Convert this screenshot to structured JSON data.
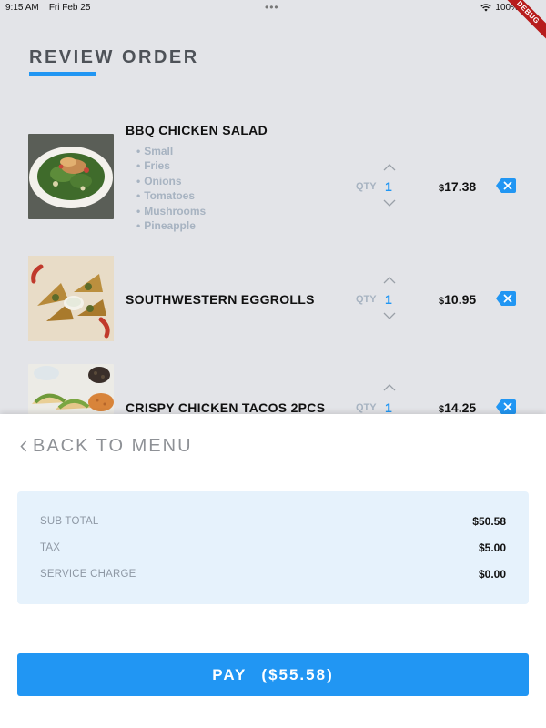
{
  "status_bar": {
    "time": "9:15 AM",
    "date": "Fri Feb 25",
    "center_dots": "•••",
    "battery": "100%",
    "debug_label": "DEBUG"
  },
  "header": {
    "title": "REVIEW ORDER"
  },
  "order_items": [
    {
      "name": "BBQ CHICKEN SALAD",
      "modifiers": [
        "Small",
        "Fries",
        "Onions",
        "Tomatoes",
        "Mushrooms",
        "Pineapple"
      ],
      "qty_label": "QTY",
      "qty": "1",
      "currency": "$",
      "price": "17.38"
    },
    {
      "name": "SOUTHWESTERN EGGROLLS",
      "modifiers": [],
      "qty_label": "QTY",
      "qty": "1",
      "currency": "$",
      "price": "10.95"
    },
    {
      "name": "CRISPY CHICKEN TACOS 2PCS",
      "modifiers": [],
      "qty_label": "QTY",
      "qty": "1",
      "currency": "$",
      "price": "14.25"
    }
  ],
  "bottom_sheet": {
    "back_label": "BACK TO MENU",
    "summary": [
      {
        "label": "SUB TOTAL",
        "value": "$50.58"
      },
      {
        "label": "TAX",
        "value": "$5.00"
      },
      {
        "label": "SERVICE CHARGE",
        "value": "$0.00"
      }
    ],
    "pay_label": "PAY",
    "pay_amount": "($55.58)"
  },
  "colors": {
    "accent": "#2196f3",
    "background": "#e3e4e8",
    "modifier_text": "#a7b3c1",
    "summary_bg": "#e6f2fc",
    "debug_banner": "#b71c1c"
  }
}
